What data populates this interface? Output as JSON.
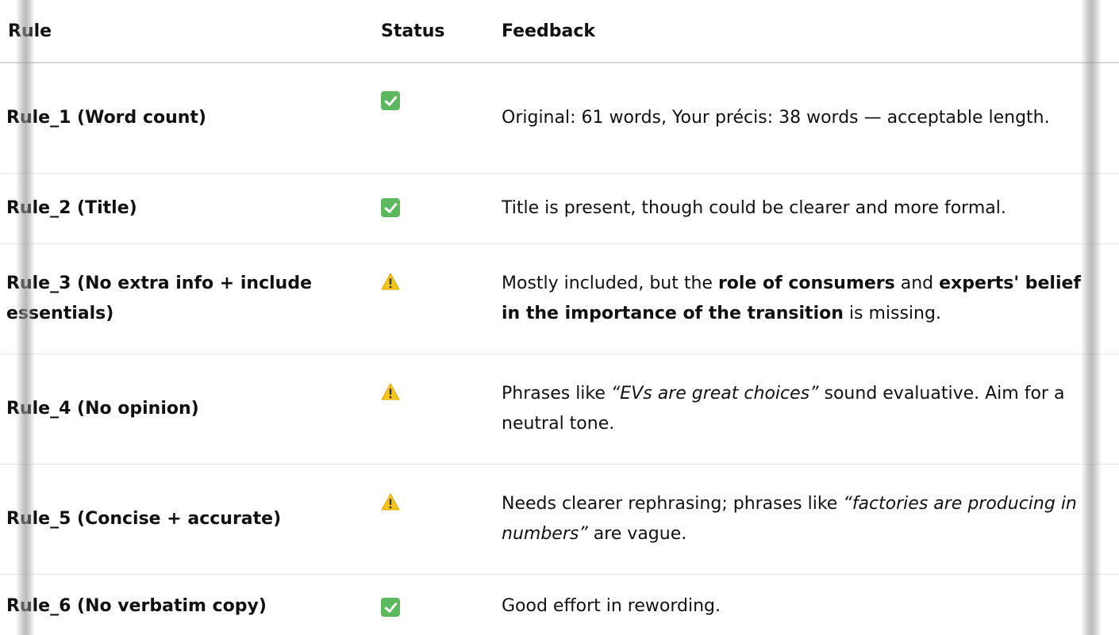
{
  "table": {
    "headers": {
      "rule": "Rule",
      "status": "Status",
      "feedback": "Feedback"
    },
    "rows": [
      {
        "rule": "Rule_1 (Word count)",
        "status_icon": "check-icon",
        "feedback": {
          "text": "Original: 61 words, Your précis: 38 words — acceptable length."
        }
      },
      {
        "rule": "Rule_2 (Title)",
        "status_icon": "check-icon",
        "feedback": {
          "text": "Title is present, though could be clearer and more formal."
        }
      },
      {
        "rule": "Rule_3 (No extra info + include essentials)",
        "status_icon": "warning-icon",
        "feedback": {
          "p1": "Mostly included, but the ",
          "b1": "role of consumers",
          "p2": " and ",
          "b2": "experts' belief in the importance of the transition",
          "p3": " is missing."
        }
      },
      {
        "rule": "Rule_4 (No opinion)",
        "status_icon": "warning-icon",
        "feedback": {
          "p1": "Phrases like ",
          "i1": "“EVs are great choices”",
          "p2": " sound evaluative. Aim for a neutral tone."
        }
      },
      {
        "rule": "Rule_5 (Concise + accurate)",
        "status_icon": "warning-icon",
        "feedback": {
          "p1": "Needs clearer rephrasing; phrases like ",
          "i1": "“factories are producing in numbers”",
          "p2": " are vague."
        }
      },
      {
        "rule": "Rule_6 (No verbatim copy)",
        "status_icon": "check-icon",
        "feedback": {
          "text": "Good effort in rewording."
        }
      }
    ]
  },
  "colors": {
    "check_green": "#5cb85c",
    "warning_yellow": "#f5c518",
    "divider": "#e6e6e6"
  }
}
